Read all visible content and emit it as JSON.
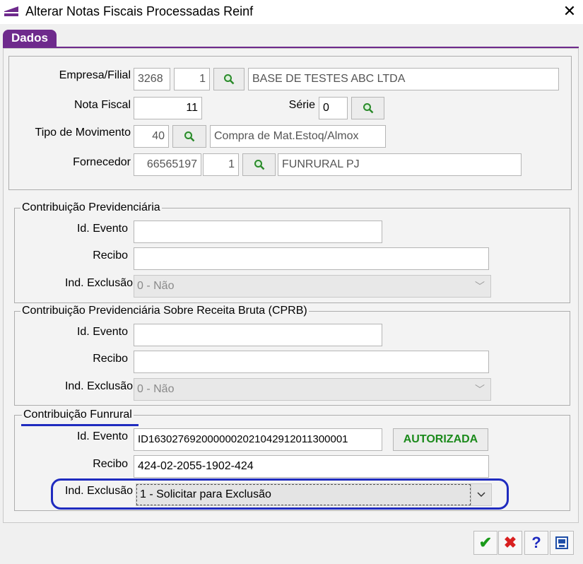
{
  "window": {
    "title": "Alterar Notas Fiscais Processadas Reinf"
  },
  "tab": {
    "label": "Dados"
  },
  "header": {
    "empresa_label": "Empresa/Filial",
    "empresa_code": "3268",
    "filial_code": "1",
    "empresa_name": "BASE DE TESTES ABC LTDA",
    "nota_label": "Nota Fiscal",
    "nota_value": "11",
    "serie_label": "Série",
    "serie_value": "0",
    "tipo_label": "Tipo de Movimento",
    "tipo_code": "40",
    "tipo_desc": "Compra de Mat.Estoq/Almox",
    "fornecedor_label": "Fornecedor",
    "fornecedor_code": "66565197",
    "fornecedor_seq": "1",
    "fornecedor_name": "FUNRURAL PJ"
  },
  "prev": {
    "legend": "Contribuição Previdenciária",
    "id_label": "Id. Evento",
    "id_value": "",
    "recibo_label": "Recibo",
    "recibo_value": "",
    "excl_label": "Ind. Exclusão",
    "excl_value": "0 - Não"
  },
  "cprb": {
    "legend": "Contribuição Previdenciária Sobre Receita Bruta (CPRB)",
    "id_label": "Id. Evento",
    "id_value": "",
    "recibo_label": "Recibo",
    "recibo_value": "",
    "excl_label": "Ind. Exclusão",
    "excl_value": "0 - Não"
  },
  "funrural": {
    "legend": "Contribuição Funrural",
    "id_label": "Id. Evento",
    "id_value": "ID1630276920000002021042912011300001",
    "status": "AUTORIZADA",
    "recibo_label": "Recibo",
    "recibo_value": "424-02-2055-1902-424",
    "excl_label": "Ind. Exclusão",
    "excl_value": "1 - Solicitar para Exclusão"
  },
  "footer": {
    "confirm_icon": "check-icon",
    "cancel_icon": "x-icon",
    "help_label": "?",
    "print_icon": "print-icon"
  },
  "colors": {
    "accent": "#6e2a8c",
    "annotation": "#1f2bbf",
    "status": "#1b8a1b"
  }
}
